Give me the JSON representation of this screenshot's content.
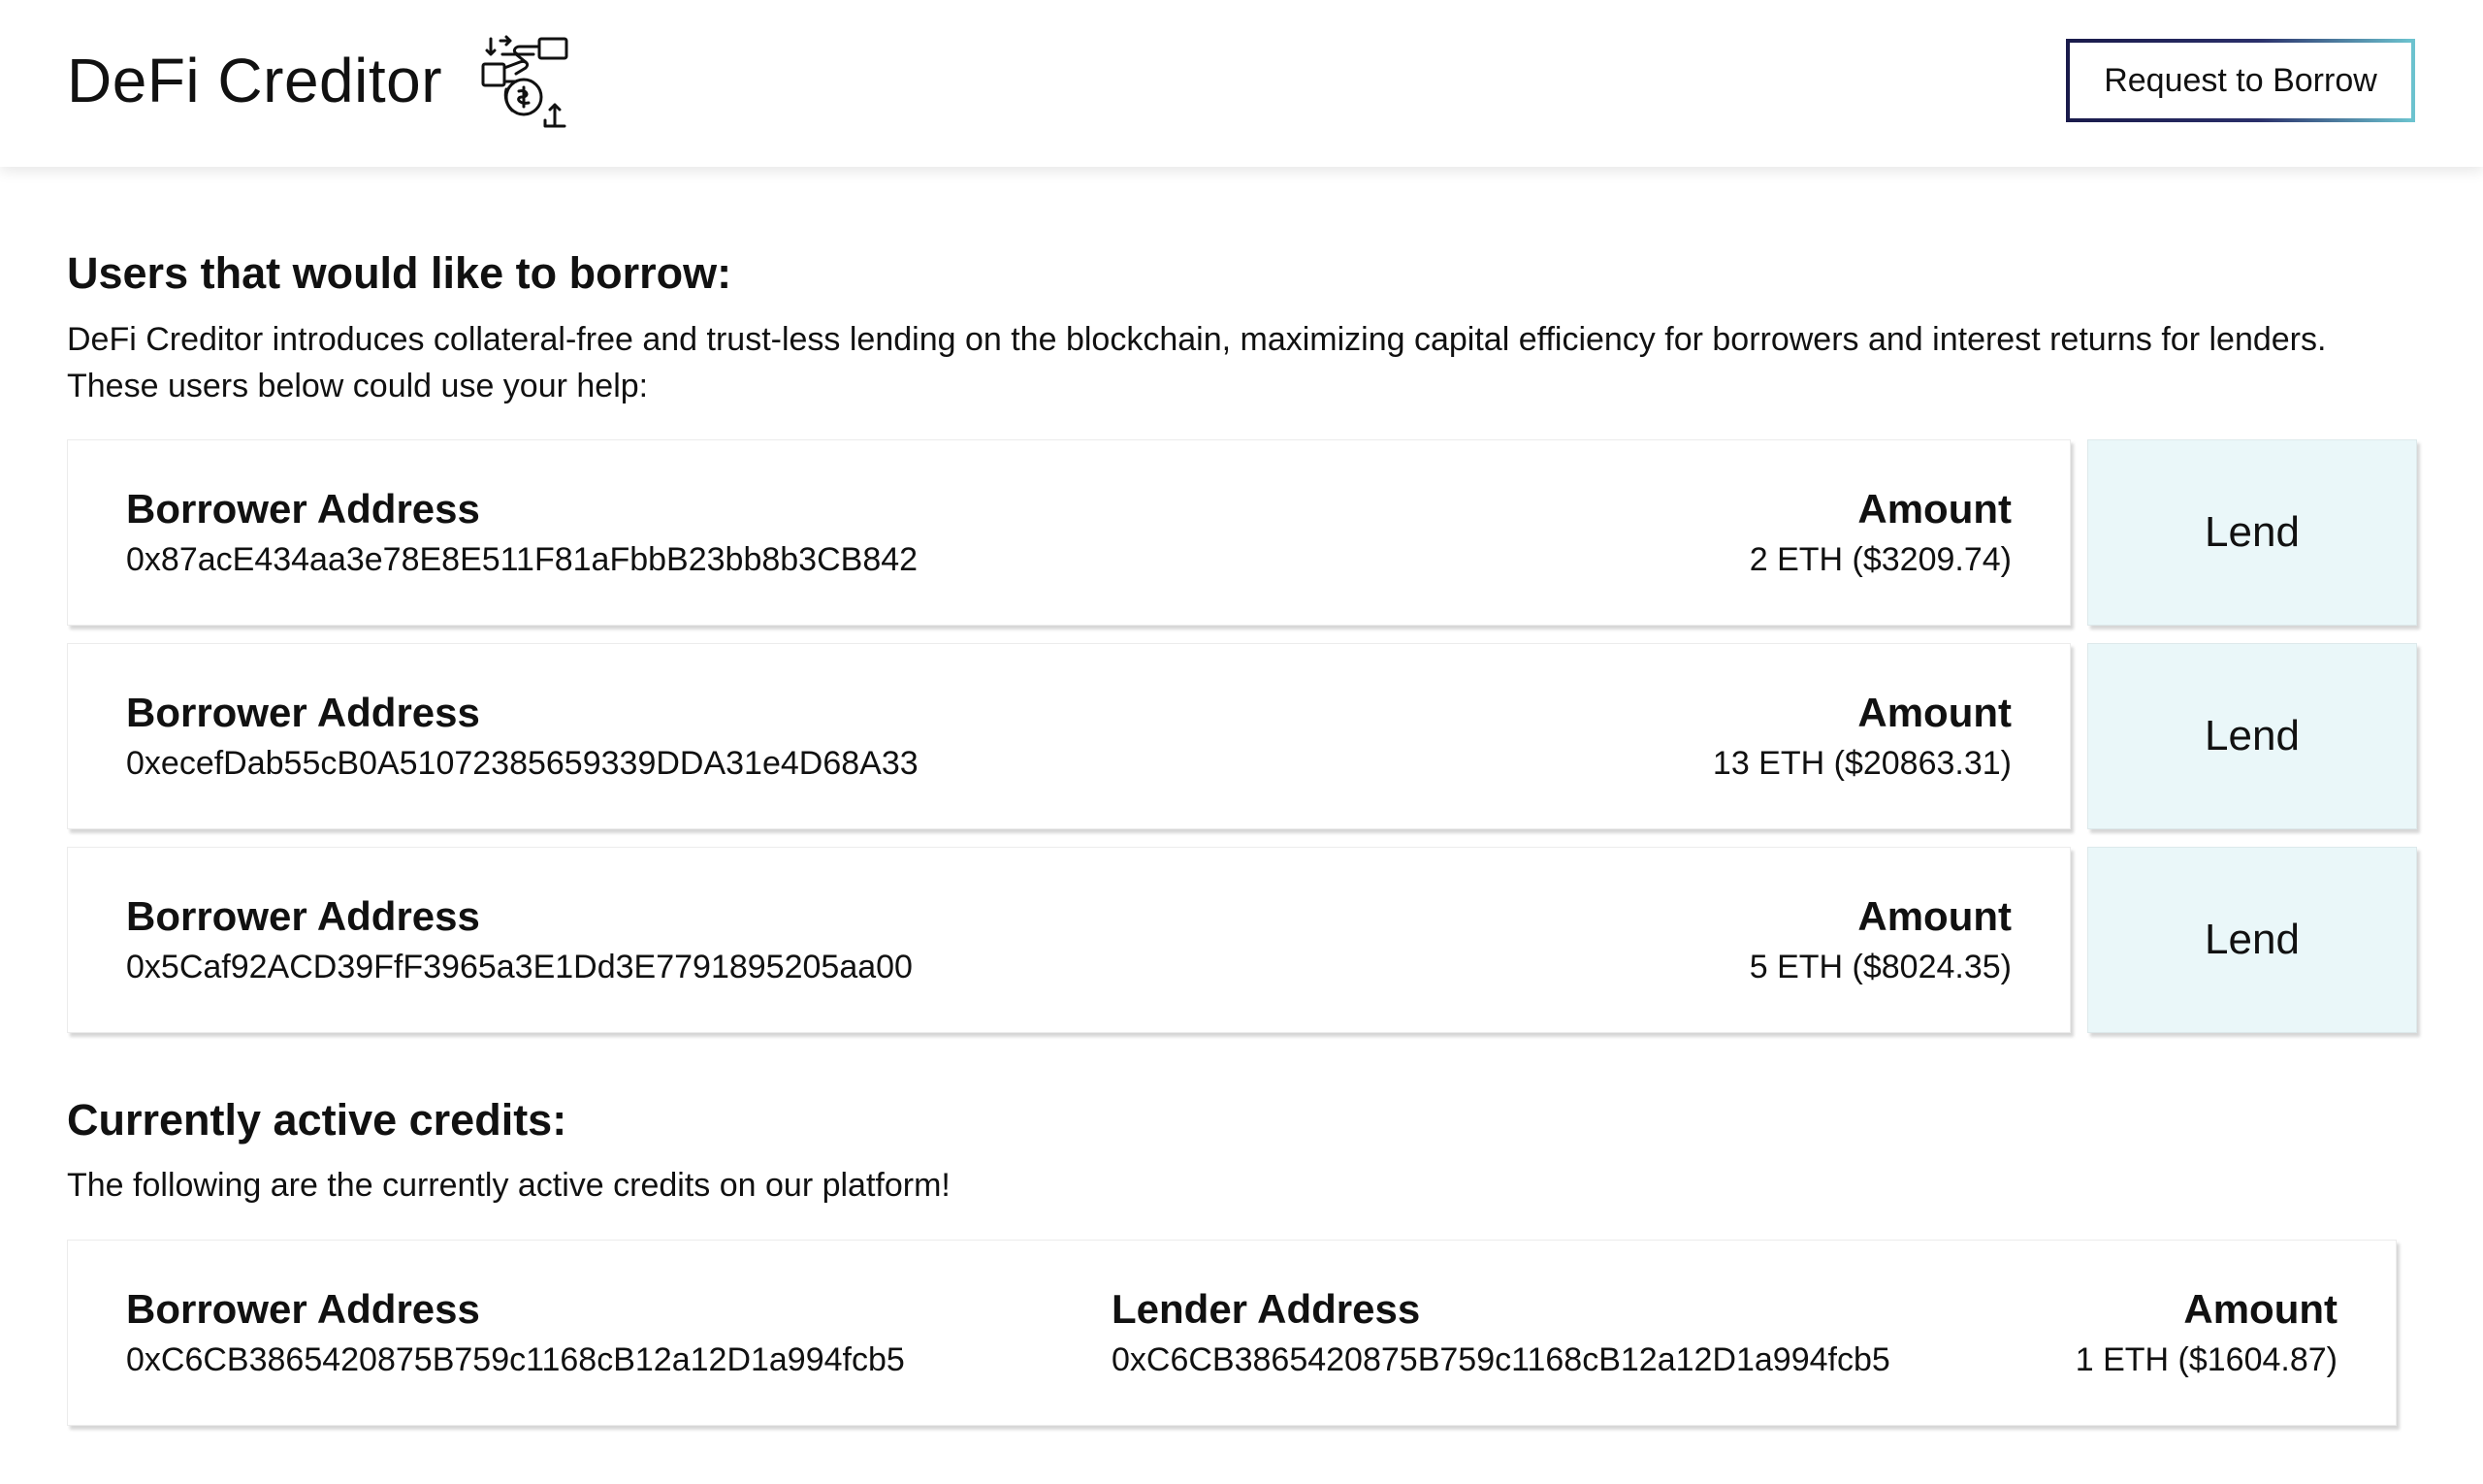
{
  "header": {
    "app_title": "DeFi Creditor",
    "logo_icon": "handshake-coins-icon",
    "request_button_label": "Request to Borrow"
  },
  "borrow_section": {
    "title": "Users that would like to borrow:",
    "description": "DeFi Creditor introduces collateral-free and trust-less lending on the blockchain, maximizing capital efficiency for borrowers and interest returns for lenders. These users below could use your help:",
    "requests": [
      {
        "address_label": "Borrower Address",
        "address": "0x87acE434aa3e78E8E511F81aFbbB23bb8b3CB842",
        "amount_label": "Amount",
        "amount": "2 ETH ($3209.74)",
        "lend_label": "Lend"
      },
      {
        "address_label": "Borrower Address",
        "address": "0xecefDab55cB0A51072385659339DDA31e4D68A33",
        "amount_label": "Amount",
        "amount": "13 ETH ($20863.31)",
        "lend_label": "Lend"
      },
      {
        "address_label": "Borrower Address",
        "address": "0x5Caf92ACD39FfF3965a3E1Dd3E7791895205aa00",
        "amount_label": "Amount",
        "amount": "5 ETH ($8024.35)",
        "lend_label": "Lend"
      }
    ]
  },
  "active_section": {
    "title": "Currently active credits:",
    "description": "The following are the currently active credits on our platform!",
    "credits": [
      {
        "borrower_label": "Borrower Address",
        "borrower": "0xC6CB3865420875B759c1168cB12a12D1a994fcb5",
        "lender_label": "Lender Address",
        "lender": "0xC6CB3865420875B759c1168cB12a12D1a994fcb5",
        "amount_label": "Amount",
        "amount": "1 ETH ($1604.87)"
      }
    ]
  },
  "colors": {
    "lend_button_bg": "#eaf7f9",
    "request_border_start": "#1a1b4b",
    "request_border_end": "#6cc3cf"
  }
}
